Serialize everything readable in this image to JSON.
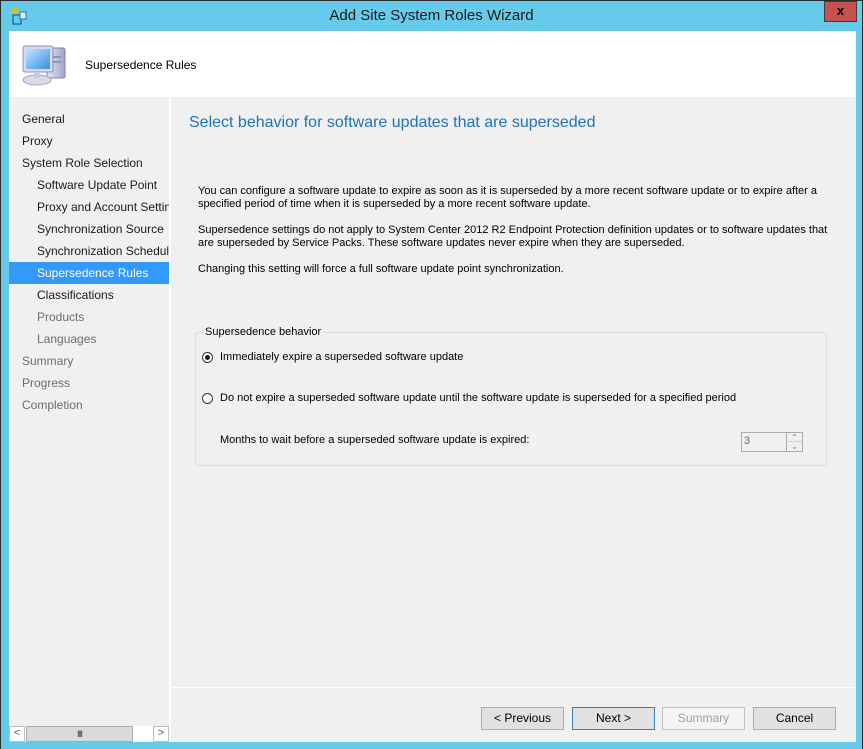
{
  "window": {
    "title": "Add Site System Roles Wizard",
    "close_label": "x",
    "accent_color": "#66CBEA"
  },
  "header": {
    "title": "Supersedence Rules"
  },
  "sidebar": {
    "items": [
      {
        "label": "General",
        "level": 0,
        "state": "done"
      },
      {
        "label": "Proxy",
        "level": 0,
        "state": "done"
      },
      {
        "label": "System Role Selection",
        "level": 0,
        "state": "done"
      },
      {
        "label": "Software Update Point",
        "level": 1,
        "state": "done"
      },
      {
        "label": "Proxy and Account Settings",
        "level": 1,
        "state": "done"
      },
      {
        "label": "Synchronization Source",
        "level": 1,
        "state": "done"
      },
      {
        "label": "Synchronization Schedule",
        "level": 1,
        "state": "done"
      },
      {
        "label": "Supersedence Rules",
        "level": 1,
        "state": "active"
      },
      {
        "label": "Classifications",
        "level": 1,
        "state": "done"
      },
      {
        "label": "Products",
        "level": 1,
        "state": "future"
      },
      {
        "label": "Languages",
        "level": 1,
        "state": "future"
      },
      {
        "label": "Summary",
        "level": 0,
        "state": "future"
      },
      {
        "label": "Progress",
        "level": 0,
        "state": "future"
      },
      {
        "label": "Completion",
        "level": 0,
        "state": "future"
      }
    ],
    "scroll_left": "<",
    "scroll_right": ">",
    "scroll_thumb": "III"
  },
  "main": {
    "title": "Select behavior for software updates that are superseded",
    "paragraphs": [
      "You can configure a software update to expire as soon as it is superseded by a more recent software update or to expire after a specified period of time when it is superseded by a more recent software update.",
      "Supersedence settings do not apply to System Center 2012 R2 Endpoint Protection definition updates or to software updates that are superseded by Service Packs. These software updates never expire when they are superseded.",
      "Changing this setting will force a full software update point synchronization."
    ],
    "group": {
      "legend": "Supersedence behavior",
      "options": [
        {
          "label": "Immediately expire a superseded software update",
          "checked": true
        },
        {
          "label": "Do not expire a superseded software update until the software update is superseded for a specified period",
          "checked": false
        }
      ],
      "months_label": "Months to wait before a superseded software update is expired:",
      "months_value": "3",
      "months_enabled": false
    }
  },
  "footer": {
    "previous_label": "< Previous",
    "next_label": "Next >",
    "summary_label": "Summary",
    "cancel_label": "Cancel"
  }
}
